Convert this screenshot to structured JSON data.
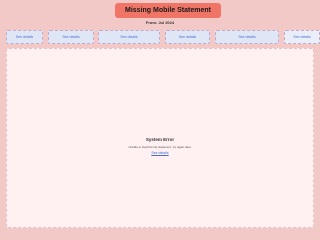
{
  "header": {
    "title": "Missing Mobile Statement",
    "subtitle": "From: Jul 2024"
  },
  "cards": [
    {
      "label": "See details"
    },
    {
      "label": "See details"
    },
    {
      "label": "See details"
    },
    {
      "label": "See details"
    },
    {
      "label": "See details"
    },
    {
      "label": "See details"
    }
  ],
  "panel": {
    "error_title": "System Error",
    "error_message": "Unable to load the list statement, try again later.",
    "error_link": "See details"
  },
  "colors": {
    "background": "#f2c9c6",
    "title_pill": "#f07566",
    "card_fill": "#dfe7f7",
    "link": "#4a6fd1",
    "panel": "#fff0f2"
  }
}
